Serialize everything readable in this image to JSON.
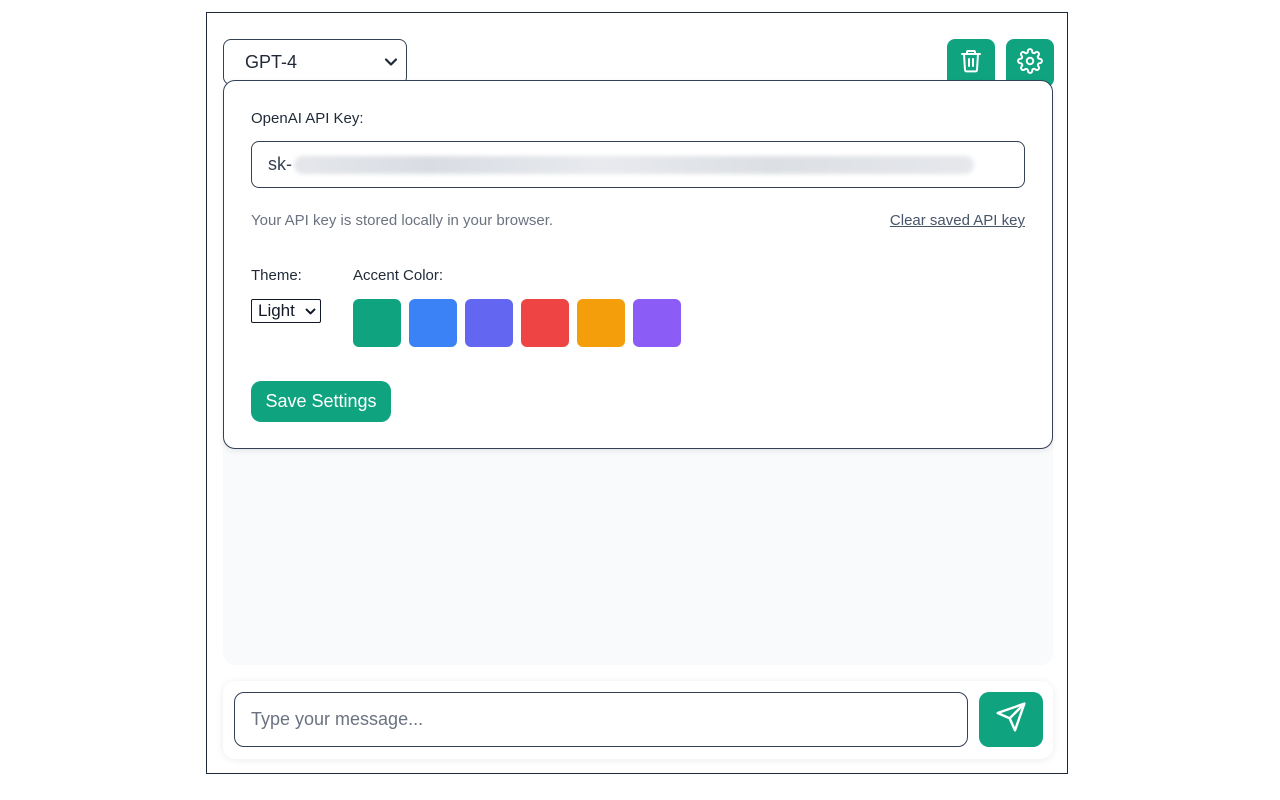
{
  "model_selector": {
    "value": "GPT-4"
  },
  "colors": {
    "accent": "#10a37f",
    "border": "#334155"
  },
  "header": {
    "clear_icon": "trash-icon",
    "settings_icon": "gear-icon"
  },
  "settings": {
    "api_key_label": "OpenAI API Key:",
    "api_key_value_prefix": "sk-",
    "storage_hint": "Your API key is stored locally in your browser.",
    "clear_link": "Clear saved API key",
    "theme_label": "Theme:",
    "theme_value": "Light",
    "accent_label": "Accent Color:",
    "accent_swatches": [
      "#10a37f",
      "#3b82f6",
      "#6366f1",
      "#ef4444",
      "#f59e0b",
      "#8b5cf6"
    ],
    "save_label": "Save Settings"
  },
  "composer": {
    "placeholder": "Type your message...",
    "send_icon": "send-icon"
  }
}
